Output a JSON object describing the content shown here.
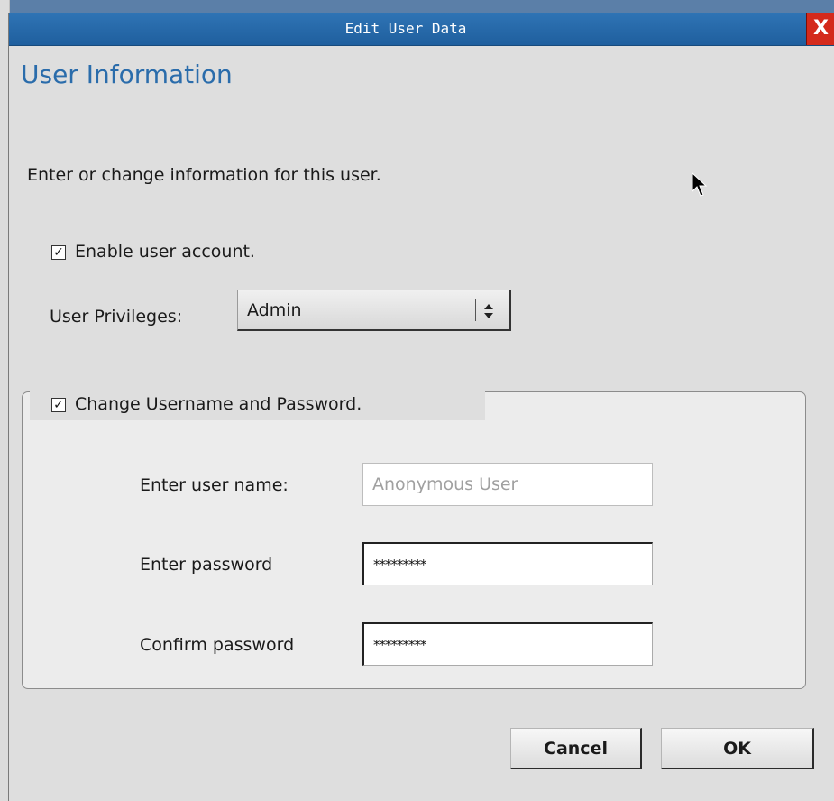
{
  "window": {
    "title": "Edit User Data",
    "close_glyph": "X"
  },
  "heading": "User Information",
  "intro": "Enter or change information for this user.",
  "enable_account": {
    "checked": true,
    "label": "Enable user account.",
    "mark": "✓"
  },
  "privileges": {
    "label": "User Privileges:",
    "selected": "Admin"
  },
  "credentials_group": {
    "checked": true,
    "mark": "✓",
    "label": "Change Username and Password.",
    "username_label": "Enter user name:",
    "username_value": "Anonymous User",
    "password_label": "Enter password",
    "password_value": "*********",
    "confirm_label": "Confirm password",
    "confirm_value": "*********"
  },
  "buttons": {
    "cancel": "Cancel",
    "ok": "OK"
  },
  "icons": {
    "close": "close-icon",
    "checkbox": "checkmark-icon",
    "select_arrows": "up-down-arrows-icon",
    "cursor": "mouse-pointer-icon"
  },
  "colors": {
    "titlebar": "#2667a8",
    "close": "#d42a1c",
    "heading": "#2a6cab"
  }
}
